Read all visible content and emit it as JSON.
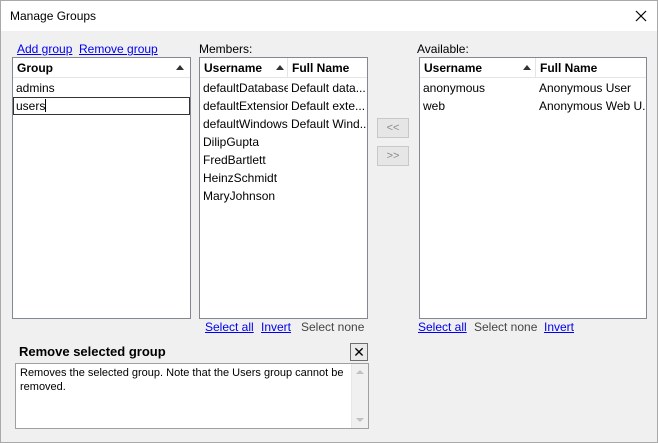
{
  "window": {
    "title": "Manage Groups"
  },
  "groups_panel": {
    "add_label": "Add group",
    "remove_label": "Remove group",
    "header": "Group",
    "items": [
      "admins"
    ],
    "editing_value": "users"
  },
  "members": {
    "label": "Members:",
    "columns": [
      "Username",
      "Full Name"
    ],
    "rows": [
      [
        "defaultDatabase",
        "Default data..."
      ],
      [
        "defaultExtension",
        "Default exte..."
      ],
      [
        "defaultWindows",
        "Default Wind..."
      ],
      [
        "DilipGupta",
        ""
      ],
      [
        "FredBartlett",
        ""
      ],
      [
        "HeinzSchmidt",
        ""
      ],
      [
        "MaryJohnson",
        ""
      ]
    ],
    "select_all": "Select all",
    "invert": "Invert",
    "select_none": "Select none"
  },
  "transfer": {
    "add_label": "<<",
    "remove_label": ">>"
  },
  "available": {
    "label": "Available:",
    "columns": [
      "Username",
      "Full Name"
    ],
    "rows": [
      [
        "anonymous",
        "Anonymous User"
      ],
      [
        "web",
        "Anonymous Web U..."
      ]
    ],
    "select_all": "Select all",
    "select_none": "Select none",
    "invert": "Invert"
  },
  "help": {
    "title": "Remove selected group",
    "text": "Removes the selected group.  Note that the Users group cannot be removed."
  }
}
